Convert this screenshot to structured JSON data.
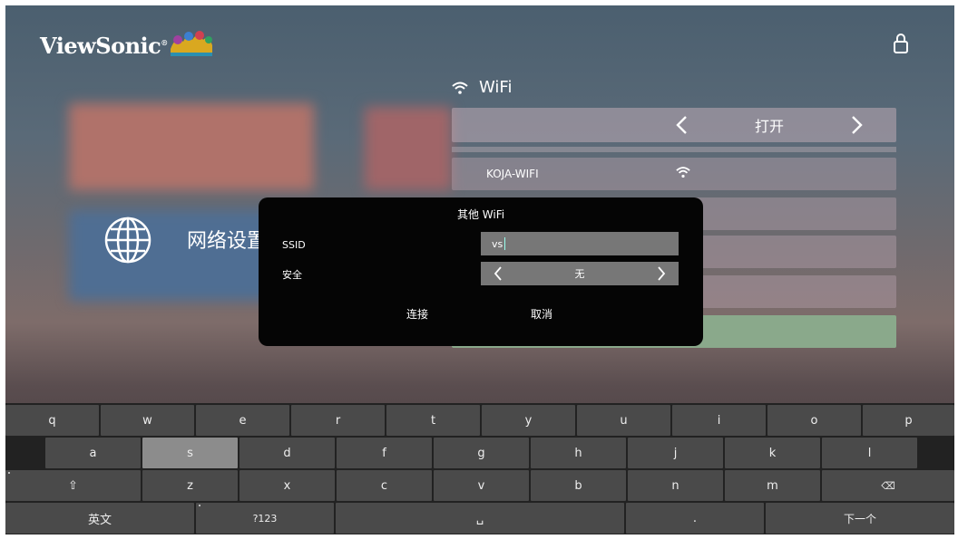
{
  "header": {
    "brand": "ViewSonic",
    "brand_mark": "®"
  },
  "wifi_panel": {
    "title": "WiFi",
    "toggle_value": "打开",
    "networks": [
      {
        "ssid": "KOJA-WIFI"
      }
    ]
  },
  "settings_item": {
    "label": "网络设置",
    "icon": "globe-icon"
  },
  "dialog": {
    "title": "其他 WiFi",
    "ssid_label": "SSID",
    "ssid_value": "vs",
    "security_label": "安全",
    "security_value": "无",
    "connect_label": "连接",
    "cancel_label": "取消"
  },
  "keyboard": {
    "row1": [
      "q",
      "w",
      "e",
      "r",
      "t",
      "y",
      "u",
      "i",
      "o",
      "p"
    ],
    "row2": [
      "a",
      "s",
      "d",
      "f",
      "g",
      "h",
      "j",
      "k",
      "l"
    ],
    "row3": [
      "⇧",
      "z",
      "x",
      "c",
      "v",
      "b",
      "n",
      "m",
      "⌫"
    ],
    "row4": {
      "lang": "英文",
      "symbols": "?123",
      "space": "␣",
      "period": ".",
      "next": "下一个"
    },
    "highlighted": "s"
  },
  "colors": {
    "dialog_bg": "#050505",
    "field_bg": "#777777",
    "selected_row": "#8aa98b",
    "key_bg": "#4a4a4a",
    "key_highlight": "#8c8c8c"
  }
}
